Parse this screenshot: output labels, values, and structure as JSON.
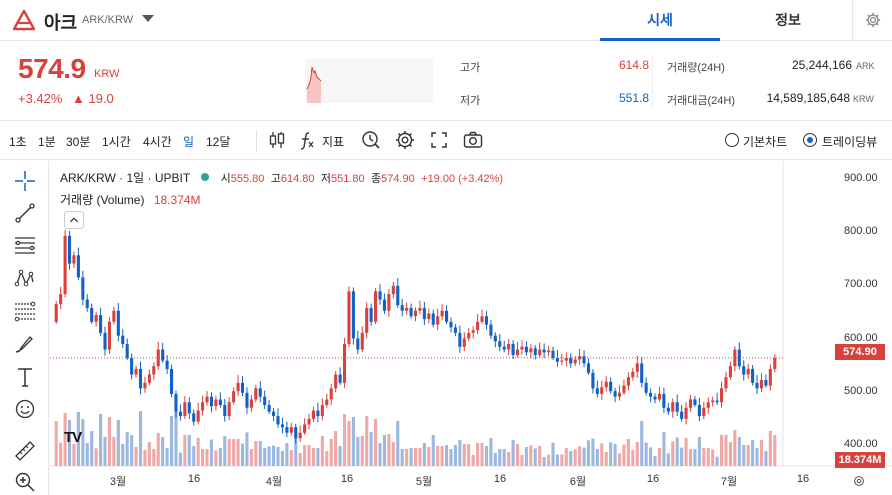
{
  "header": {
    "coin_name": "아크",
    "pair": "ARK/KRW",
    "tabs": [
      {
        "label": "시세",
        "active": true
      },
      {
        "label": "정보",
        "active": false
      }
    ]
  },
  "ticker": {
    "price": "574.9",
    "unit": "KRW",
    "change_pct": "+3.42%",
    "change_abs": "▲ 19.0",
    "stats": {
      "high_label": "고가",
      "high": "614.8",
      "low_label": "저가",
      "low": "551.8",
      "volume_label": "거래량(24H)",
      "volume": "25,244,166",
      "volume_unit": "ARK",
      "amount_label": "거래대금(24H)",
      "amount": "14,589,185,648",
      "amount_unit": "KRW"
    },
    "colors": {
      "up": "#d9413d",
      "down": "#1261c4"
    }
  },
  "toolbar": {
    "intervals": [
      "1초",
      "1분",
      "30분",
      "1시간",
      "4시간",
      "일",
      "12달"
    ],
    "active_interval": "일",
    "indicator_label": "지표",
    "chart_modes": [
      {
        "label": "기본차트",
        "selected": false
      },
      {
        "label": "트레이딩뷰",
        "selected": true
      }
    ]
  },
  "chart": {
    "legend": {
      "symbol": "ARK/KRW · 1일 · UPBIT",
      "open_label": "시",
      "open": "555.80",
      "high_label": "고",
      "high": "614.80",
      "low_label": "저",
      "low": "551.80",
      "close_label": "종",
      "close": "574.90",
      "change": "+19.00 (+3.42%)",
      "volume_label": "거래량 (Volume)",
      "volume": "18.374M"
    },
    "price_tag": "574.90",
    "volume_tag": "18.374M",
    "y_ticks": [
      "900.00",
      "800.00",
      "700.00",
      "600.00",
      "500.00",
      "400.00"
    ],
    "x_ticks": [
      "3월",
      "16",
      "4월",
      "16",
      "5월",
      "16",
      "6월",
      "16",
      "7월",
      "16"
    ]
  },
  "chart_data": {
    "type": "candlestick",
    "ylim": [
      380,
      930
    ],
    "current_price": 574.9,
    "values": [
      [
        640,
        672
      ],
      [
        672,
        690
      ],
      [
        690,
        795
      ],
      [
        795,
        745
      ],
      [
        745,
        760
      ],
      [
        760,
        720
      ],
      [
        720,
        680
      ],
      [
        680,
        665
      ],
      [
        665,
        640
      ],
      [
        640,
        652
      ],
      [
        652,
        620
      ],
      [
        620,
        590
      ],
      [
        590,
        640
      ],
      [
        640,
        660
      ],
      [
        660,
        615
      ],
      [
        615,
        600
      ],
      [
        600,
        575
      ],
      [
        575,
        545
      ],
      [
        545,
        555
      ],
      [
        555,
        520
      ],
      [
        520,
        530
      ],
      [
        530,
        545
      ],
      [
        545,
        560
      ],
      [
        560,
        590
      ],
      [
        590,
        570
      ],
      [
        570,
        555
      ],
      [
        555,
        510
      ],
      [
        510,
        478
      ],
      [
        478,
        470
      ],
      [
        470,
        495
      ],
      [
        495,
        475
      ],
      [
        475,
        460
      ],
      [
        460,
        480
      ],
      [
        480,
        495
      ],
      [
        495,
        505
      ],
      [
        505,
        488
      ],
      [
        488,
        500
      ],
      [
        500,
        490
      ],
      [
        490,
        470
      ],
      [
        470,
        495
      ],
      [
        495,
        515
      ],
      [
        515,
        530
      ],
      [
        530,
        512
      ],
      [
        512,
        485
      ],
      [
        485,
        500
      ],
      [
        500,
        520
      ],
      [
        520,
        505
      ],
      [
        505,
        490
      ],
      [
        490,
        478
      ],
      [
        478,
        470
      ],
      [
        470,
        455
      ],
      [
        455,
        450
      ],
      [
        450,
        440
      ],
      [
        440,
        450
      ],
      [
        450,
        430
      ],
      [
        430,
        440
      ],
      [
        440,
        455
      ],
      [
        455,
        465
      ],
      [
        465,
        480
      ],
      [
        480,
        470
      ],
      [
        470,
        490
      ],
      [
        490,
        500
      ],
      [
        500,
        520
      ],
      [
        520,
        545
      ],
      [
        545,
        530
      ],
      [
        530,
        600
      ],
      [
        600,
        695
      ],
      [
        695,
        610
      ],
      [
        610,
        590
      ],
      [
        590,
        620
      ],
      [
        620,
        665
      ],
      [
        665,
        640
      ],
      [
        640,
        695
      ],
      [
        695,
        680
      ],
      [
        680,
        660
      ],
      [
        660,
        690
      ],
      [
        690,
        705
      ],
      [
        705,
        670
      ],
      [
        670,
        660
      ],
      [
        660,
        665
      ],
      [
        665,
        650
      ],
      [
        650,
        660
      ],
      [
        660,
        665
      ],
      [
        665,
        645
      ],
      [
        645,
        655
      ],
      [
        655,
        635
      ],
      [
        635,
        650
      ],
      [
        650,
        660
      ],
      [
        660,
        640
      ],
      [
        640,
        630
      ],
      [
        630,
        620
      ],
      [
        620,
        595
      ],
      [
        595,
        610
      ],
      [
        610,
        620
      ],
      [
        620,
        625
      ],
      [
        625,
        640
      ],
      [
        640,
        650
      ],
      [
        650,
        635
      ],
      [
        635,
        615
      ],
      [
        615,
        605
      ],
      [
        605,
        595
      ],
      [
        595,
        590
      ],
      [
        590,
        600
      ],
      [
        600,
        580
      ],
      [
        580,
        590
      ],
      [
        590,
        595
      ],
      [
        595,
        585
      ],
      [
        585,
        592
      ],
      [
        592,
        580
      ],
      [
        580,
        590
      ],
      [
        590,
        585
      ],
      [
        585,
        588
      ],
      [
        588,
        575
      ],
      [
        575,
        568
      ],
      [
        568,
        570
      ],
      [
        570,
        575
      ],
      [
        575,
        565
      ],
      [
        565,
        572
      ],
      [
        572,
        578
      ],
      [
        578,
        565
      ],
      [
        565,
        548
      ],
      [
        548,
        520
      ],
      [
        520,
        510
      ],
      [
        510,
        522
      ],
      [
        522,
        532
      ],
      [
        532,
        515
      ],
      [
        515,
        505
      ],
      [
        505,
        512
      ],
      [
        512,
        525
      ],
      [
        525,
        540
      ],
      [
        540,
        550
      ],
      [
        550,
        565
      ],
      [
        565,
        530
      ],
      [
        530,
        512
      ],
      [
        512,
        505
      ],
      [
        505,
        500
      ],
      [
        500,
        510
      ],
      [
        510,
        485
      ],
      [
        485,
        478
      ],
      [
        478,
        495
      ],
      [
        495,
        478
      ],
      [
        478,
        465
      ],
      [
        465,
        485
      ],
      [
        485,
        500
      ],
      [
        500,
        490
      ],
      [
        490,
        470
      ],
      [
        470,
        485
      ],
      [
        485,
        495
      ],
      [
        495,
        498
      ],
      [
        498,
        495
      ],
      [
        495,
        520
      ],
      [
        520,
        540
      ],
      [
        540,
        560
      ],
      [
        560,
        590
      ],
      [
        590,
        560
      ],
      [
        560,
        545
      ],
      [
        545,
        555
      ],
      [
        555,
        530
      ],
      [
        530,
        520
      ],
      [
        520,
        535
      ],
      [
        535,
        525
      ],
      [
        525,
        555
      ],
      [
        555,
        574.9
      ]
    ]
  }
}
